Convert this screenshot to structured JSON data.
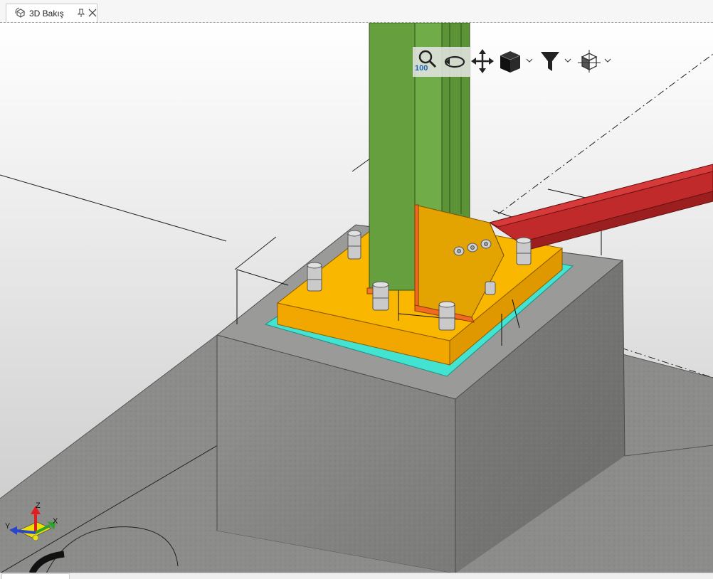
{
  "tab": {
    "label": "3D Bakış",
    "icon": "view-3d-icon",
    "pin_icon": "pin-icon",
    "close_icon": "close-icon"
  },
  "toolbar": {
    "zoom_value": "100",
    "buttons": [
      "zoom-icon",
      "orbit-icon",
      "pan-icon",
      "view-cube-icon",
      "filter-icon",
      "section-box-icon"
    ],
    "dropdowns": [
      "view-cube-dropdown",
      "filter-dropdown",
      "section-box-dropdown"
    ]
  },
  "axis_gizmo": {
    "x_label": "X",
    "y_label": "Y",
    "z_label": "Z",
    "x_color": "#2ea12e",
    "y_color": "#2b45c8",
    "z_color": "#e02020"
  },
  "scene": {
    "column_color": "#68a140",
    "base_plate_color": "#f7b400",
    "gusset_color": "#e0a200",
    "grout_color": "#40e0d0",
    "beam_color": "#b82828",
    "concrete_color": "#8a8a88",
    "bolt_color": "#c8c8c8"
  }
}
